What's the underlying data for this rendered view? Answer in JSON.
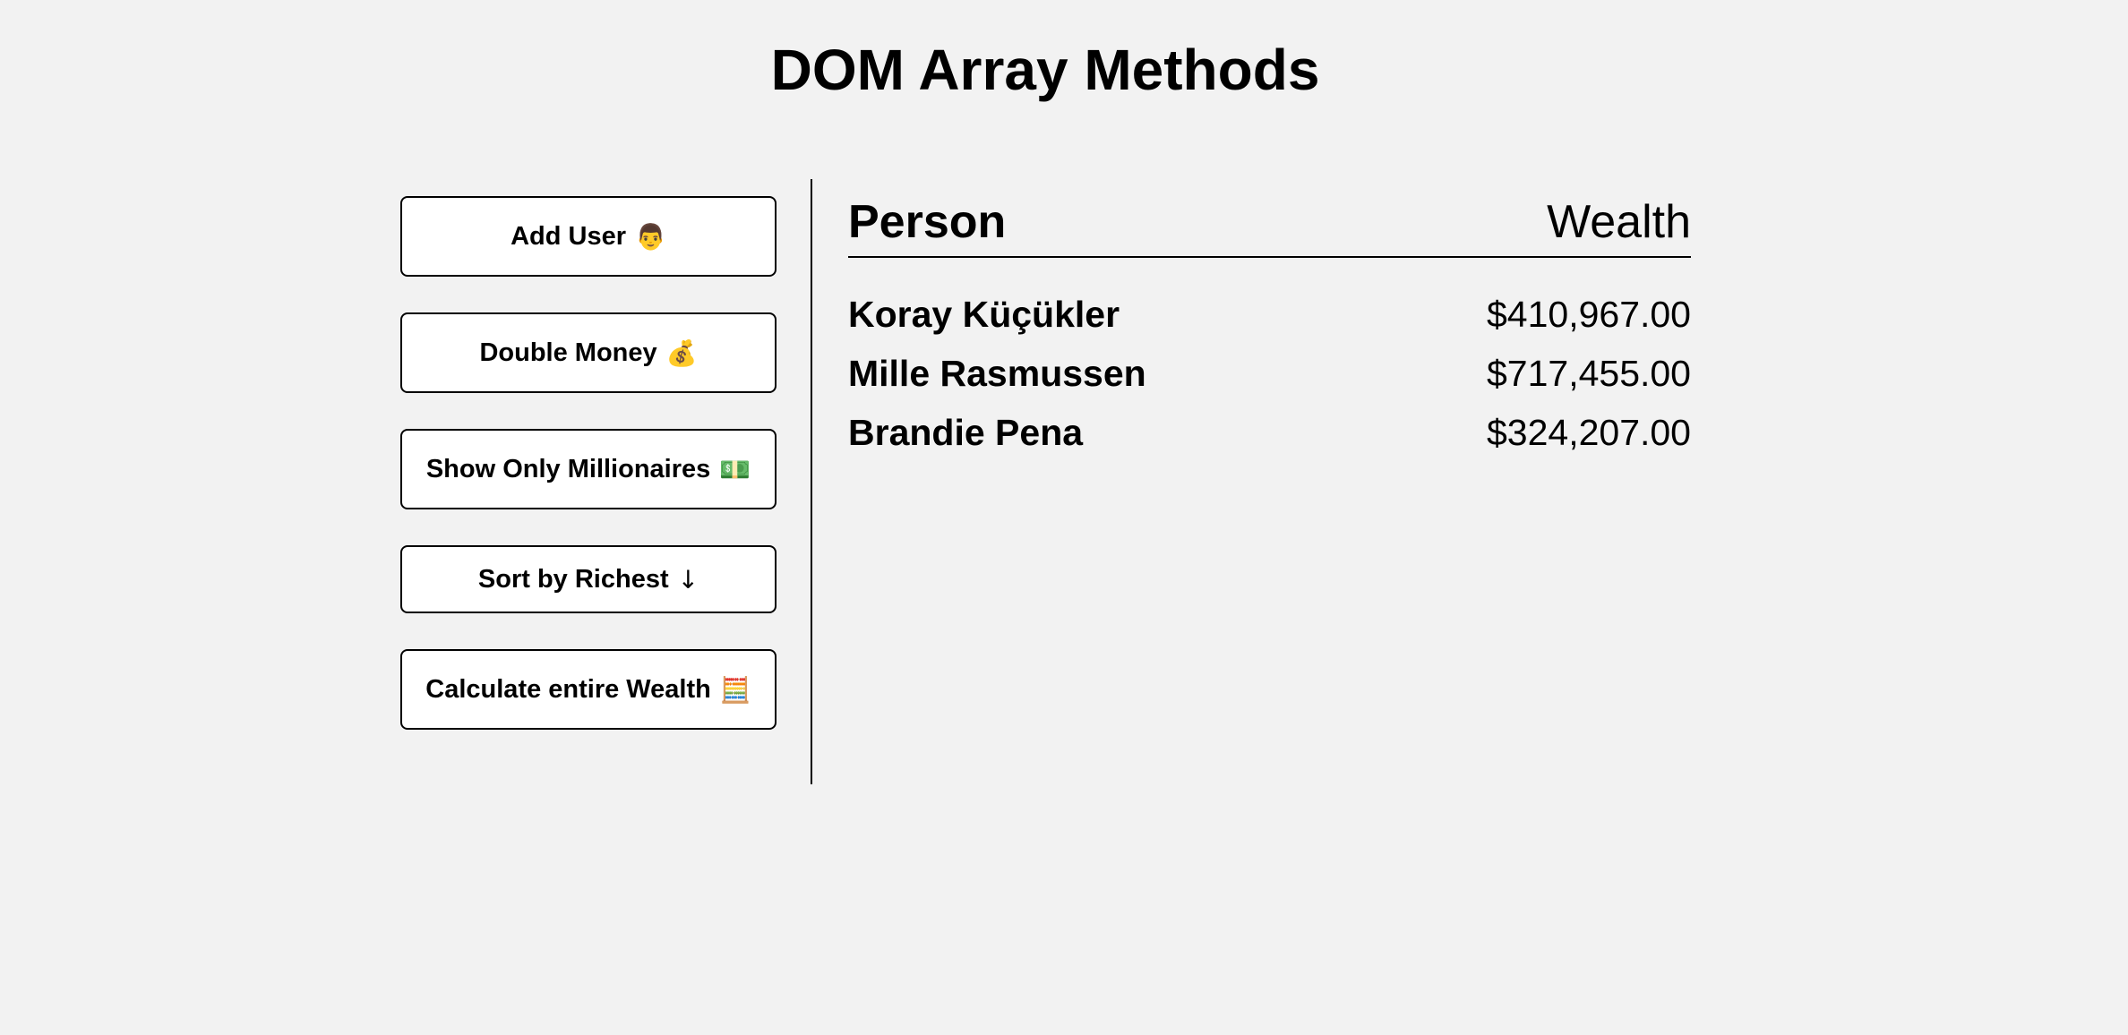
{
  "page": {
    "title": "DOM Array Methods"
  },
  "controls": {
    "buttons": [
      {
        "label": "Add User",
        "icon": "👨",
        "icon_name": "man-icon"
      },
      {
        "label": "Double Money",
        "icon": "💰",
        "icon_name": "money-bag-icon"
      },
      {
        "label": "Show Only Millionaires",
        "icon": "💵",
        "icon_name": "dollar-banknote-icon"
      },
      {
        "label": "Sort by Richest",
        "icon": "↓",
        "icon_name": "arrow-down-icon"
      },
      {
        "label": "Calculate entire Wealth",
        "icon": "🧮",
        "icon_name": "abacus-icon"
      }
    ]
  },
  "table": {
    "headers": {
      "person": "Person",
      "wealth": "Wealth"
    },
    "rows": [
      {
        "name": "Koray Küçükler",
        "wealth": "$410,967.00"
      },
      {
        "name": "Mille Rasmussen",
        "wealth": "$717,455.00"
      },
      {
        "name": "Brandie Pena",
        "wealth": "$324,207.00"
      }
    ]
  },
  "colors": {
    "background": "#f2f2f2",
    "button_background": "#ffffff",
    "border": "#000000",
    "text": "#000000"
  }
}
